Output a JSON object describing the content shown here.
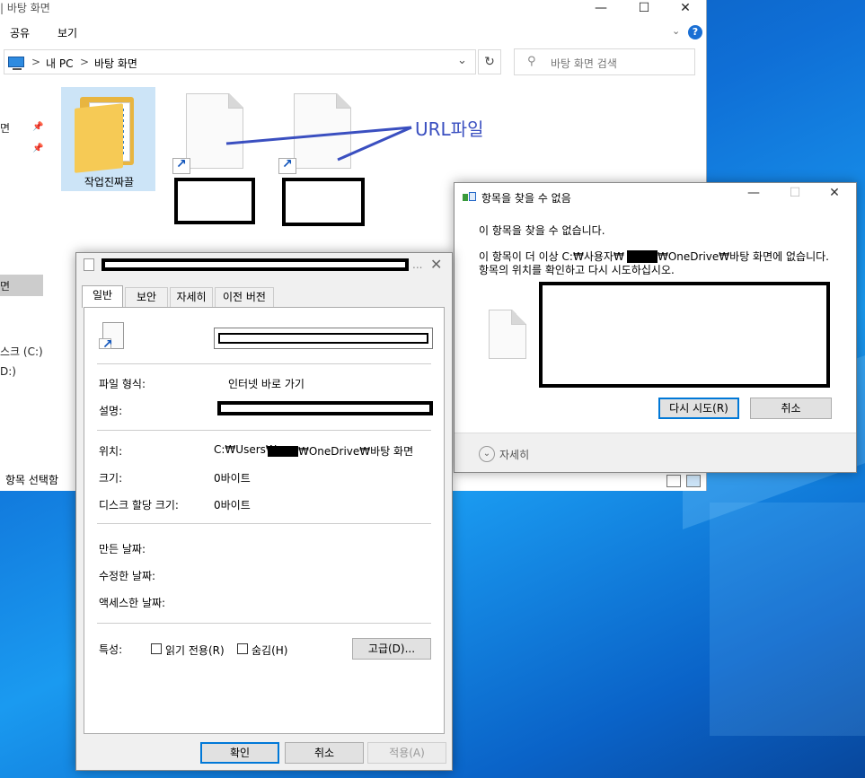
{
  "explorer": {
    "title": "| 바탕 화면",
    "ribbon_tabs": [
      "공유",
      "보기"
    ],
    "help": "?",
    "breadcrumb": [
      "내 PC",
      "바탕 화면"
    ],
    "breadcrumb_sep": ">",
    "search_placeholder": "바탕 화면 검색",
    "nav_partial": [
      "면",
      "",
      "",
      "",
      "면",
      "스크 (C:)",
      "D:)"
    ],
    "status": "항목 선택함",
    "files": [
      {
        "label": "작업진짜끌",
        "type": "folder"
      },
      {
        "label": "",
        "type": "url-shortcut"
      },
      {
        "label": "",
        "type": "url-shortcut"
      }
    ],
    "annotation": "URL파일"
  },
  "notfound": {
    "title": "항목을 찾을 수 없음",
    "line1": "이 항목을 찾을 수 없습니다.",
    "line2_a": "이 항목이 더 이상 C:₩사용자₩",
    "line2_b": "₩OneDrive₩바탕 화면에 없습니다.",
    "line3": "항목의 위치를 확인하고 다시 시도하십시오.",
    "retry": "다시 시도(R)",
    "cancel": "취소",
    "details": "자세히"
  },
  "props": {
    "tabs": [
      "일반",
      "보안",
      "자세히",
      "이전 버전"
    ],
    "file_type_label": "파일 형식:",
    "file_type_value": "인터넷 바로 가기",
    "desc_label": "설명:",
    "location_label": "위치:",
    "location_a": "C:₩Users₩",
    "location_b": "₩OneDrive₩바탕 화면",
    "size_label": "크기:",
    "size_value": "0바이트",
    "disk_label": "디스크 할당 크기:",
    "disk_value": "0바이트",
    "created_label": "만든 날짜:",
    "modified_label": "수정한 날짜:",
    "accessed_label": "액세스한 날짜:",
    "attr_label": "특성:",
    "readonly": "읽기 전용(R)",
    "hidden": "숨김(H)",
    "advanced": "고급(D)...",
    "ok": "확인",
    "cancel": "취소",
    "apply": "적용(A)"
  },
  "colors": {
    "accent": "#0078d7",
    "annotation": "#3a4fc0",
    "desktop": "#0f6fd6"
  }
}
